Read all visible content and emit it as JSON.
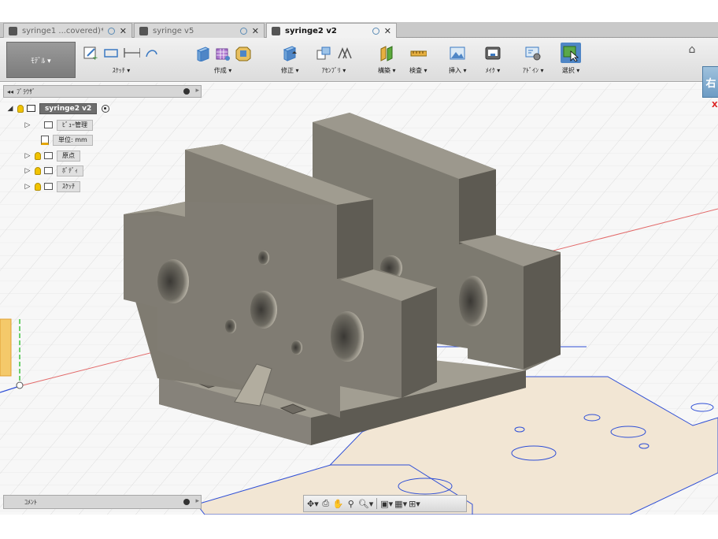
{
  "tabs": [
    {
      "label": "syringe1 ...covered)*",
      "active": false
    },
    {
      "label": "syringe v5",
      "active": false
    },
    {
      "label": "syringe2 v2",
      "active": true
    }
  ],
  "tab_close_glyph": "✕",
  "workspace": {
    "label": "ﾓﾃﾞﾙ ▾"
  },
  "ribbon": {
    "groups": [
      {
        "label": "ｽｹｯﾁ ▾",
        "icons": [
          "new-sketch-icon",
          "rectangle-icon",
          "dimension-icon",
          "spline-icon"
        ]
      },
      {
        "label": "作成 ▾",
        "icons": [
          "extrude-icon",
          "sculpt-icon",
          "insert-solid-icon"
        ]
      },
      {
        "label": "修正 ▾",
        "icons": [
          "press-pull-icon"
        ]
      },
      {
        "label": "ｱｾﾝﾌﾞﾘ ▾",
        "icons": [
          "new-component-icon",
          "joint-icon"
        ]
      },
      {
        "label": "構築 ▾",
        "icons": [
          "plane-icon"
        ]
      },
      {
        "label": "検査 ▾",
        "icons": [
          "measure-icon"
        ]
      },
      {
        "label": "挿入 ▾",
        "icons": [
          "insert-image-icon"
        ]
      },
      {
        "label": "ﾒｲｸ ▾",
        "icons": [
          "3d-print-icon"
        ]
      },
      {
        "label": "ｱﾄﾞｲﾝ ▾",
        "icons": [
          "scripts-icon"
        ]
      },
      {
        "label": "選択 ▾",
        "icons": [
          "select-icon"
        ]
      }
    ]
  },
  "viewcube": {
    "face": "右",
    "axis": "X"
  },
  "browser": {
    "title": "ﾌﾞﾗｳｻﾞ",
    "collapse_glyph": "◂◂",
    "root": "syringe2 v2",
    "items": [
      {
        "label": "ﾋﾞｭｰ管理",
        "type": "folder",
        "bulb": false
      },
      {
        "label": "単位: mm",
        "type": "doc",
        "bulb": false
      },
      {
        "label": "原点",
        "type": "folder",
        "bulb": true
      },
      {
        "label": "ﾎﾞﾃﾞｨ",
        "type": "folder",
        "bulb": true
      },
      {
        "label": "ｽｹｯﾁ",
        "type": "folder",
        "bulb": true
      }
    ]
  },
  "comments": {
    "label": "ｺﾒﾝﾄ"
  },
  "navbar": {
    "tools": [
      "orbit-icon",
      "look-at-icon",
      "pan-icon",
      "zoom-window-icon",
      "zoom-icon",
      "display-settings-icon",
      "grid-icon",
      "viewports-icon"
    ]
  },
  "colors": {
    "model_front": "#7d7a70",
    "model_side": "#5d5a52",
    "model_top": "#9c988d",
    "sketch_fill": "#f2e6d4",
    "sketch_line": "#2f4fd6",
    "grid": "#d4d4d4",
    "axis_red": "#e04040",
    "axis_green": "#40c040"
  }
}
